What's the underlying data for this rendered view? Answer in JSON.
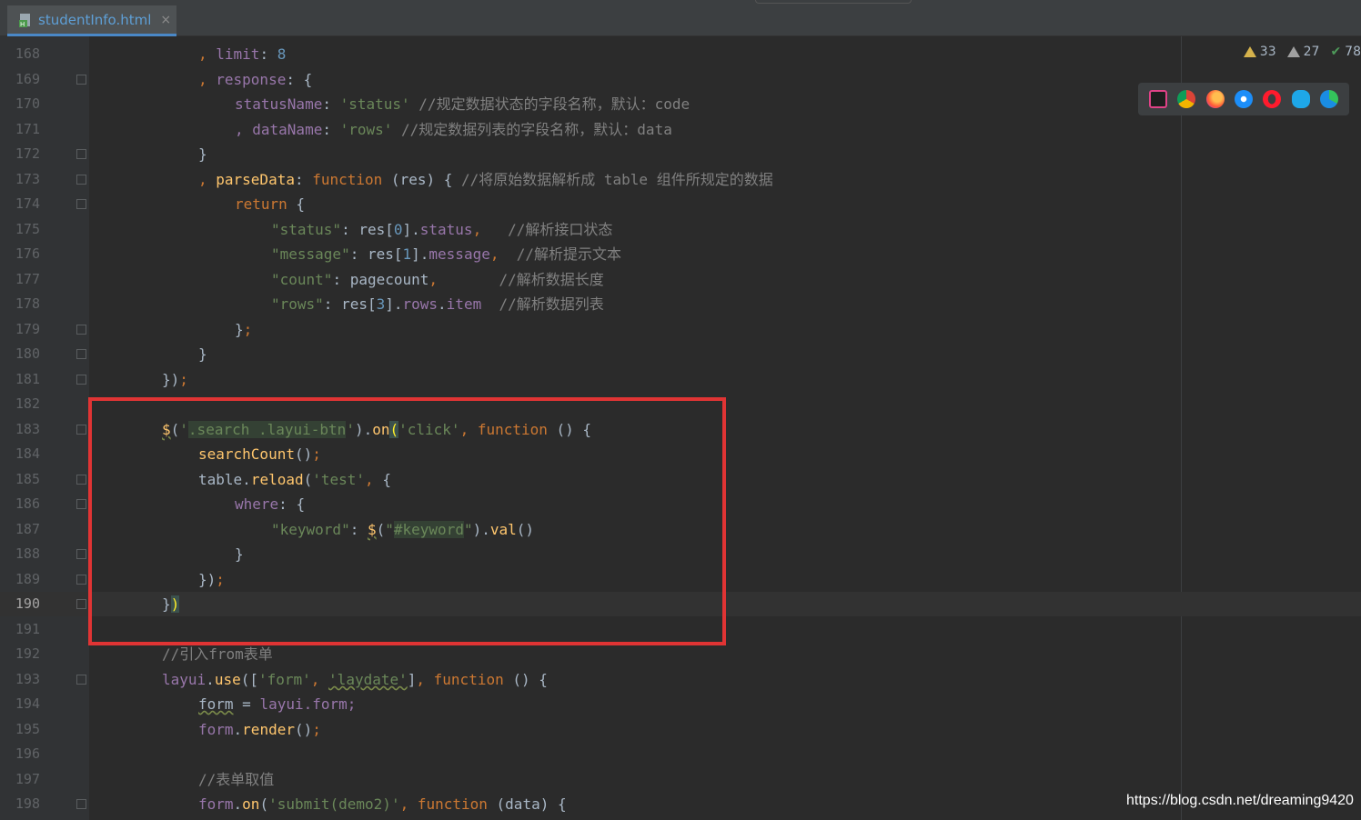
{
  "tab": {
    "filename": "studentInfo.html",
    "close": "×"
  },
  "inspections": {
    "warnings": "33",
    "weak_warnings": "27",
    "ok": "78"
  },
  "watermark": "https://blog.csdn.net/dreaming9420",
  "browsers": [
    "jetbrains-icon",
    "chrome-icon",
    "firefox-icon",
    "safari-icon",
    "opera-icon",
    "ie-icon",
    "edge-icon"
  ],
  "current_line": "190",
  "lines": [
    {
      "n": "168"
    },
    {
      "n": "169"
    },
    {
      "n": "170"
    },
    {
      "n": "171"
    },
    {
      "n": "172"
    },
    {
      "n": "173"
    },
    {
      "n": "174"
    },
    {
      "n": "175"
    },
    {
      "n": "176"
    },
    {
      "n": "177"
    },
    {
      "n": "178"
    },
    {
      "n": "179"
    },
    {
      "n": "180"
    },
    {
      "n": "181"
    },
    {
      "n": "182"
    },
    {
      "n": "183"
    },
    {
      "n": "184"
    },
    {
      "n": "185"
    },
    {
      "n": "186"
    },
    {
      "n": "187"
    },
    {
      "n": "188"
    },
    {
      "n": "189"
    },
    {
      "n": "190"
    },
    {
      "n": "191"
    },
    {
      "n": "192"
    },
    {
      "n": "193"
    },
    {
      "n": "194"
    },
    {
      "n": "195"
    },
    {
      "n": "196"
    },
    {
      "n": "197"
    },
    {
      "n": "198"
    }
  ],
  "code": {
    "l168": ", limit: 8",
    "l169": ", response: {",
    "l170_key": "statusName",
    "l170_val": "'status'",
    "l170_cmt": "//规定数据状态的字段名称，默认：code",
    "l171_key": ", dataName",
    "l171_val": "'rows'",
    "l171_cmt": "//规定数据列表的字段名称，默认：data",
    "l172": "}",
    "l173_key": "parseData",
    "l173_fn": "function",
    "l173_rest": " (res) { ",
    "l173_cmt": "//将原始数据解析成 table 组件所规定的数据",
    "l174": "return",
    "l175_key": "\"status\"",
    "l175_val": "res[0].status,",
    "l175_cmt": "//解析接口状态",
    "l176_key": "\"message\"",
    "l176_val": "res[1].message,",
    "l176_cmt": "//解析提示文本",
    "l177_key": "\"count\"",
    "l177_val": "pagecount,",
    "l177_cmt": "//解析数据长度",
    "l178_key": "\"rows\"",
    "l178_val": "res[3].rows.item",
    "l178_cmt": "//解析数据列表",
    "l179": "};",
    "l180": "}",
    "l181": "});",
    "l183_sel": ".search .layui-btn",
    "l183_evt": "'click'",
    "l183_fn": "function",
    "l184": "searchCount",
    "l185_obj": "table",
    "l185_m": "reload",
    "l185_arg": "'test'",
    "l186": "where",
    "l187_key": "\"keyword\"",
    "l187_sel": "#keyword",
    "l187_m": "val",
    "l188": "}",
    "l189": "});",
    "l190": "})",
    "l192": "//引入from表单",
    "l193_obj": "layui",
    "l193_m": "use",
    "l193_a1": "'form'",
    "l193_a2": "'laydate'",
    "l193_fn": "function",
    "l194_var": "form",
    "l194_rhs": "layui.form;",
    "l195_obj": "form",
    "l195_m": "render",
    "l197": "//表单取值",
    "l198_obj": "form",
    "l198_m": "on",
    "l198_arg": "'submit(demo2)'",
    "l198_fn": "function",
    "l198_rest": " (data) {"
  }
}
